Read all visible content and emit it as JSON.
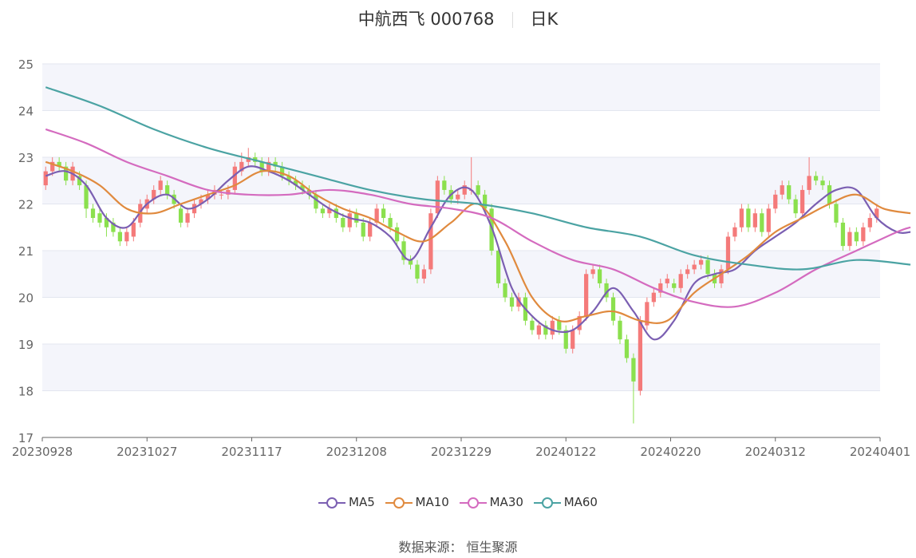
{
  "title": {
    "stock": "中航西飞 000768",
    "period": "日K"
  },
  "source": {
    "label": "数据来源：",
    "value": "恒生聚源"
  },
  "chart_data": {
    "type": "candlestick",
    "ylim": [
      17,
      25
    ],
    "yticks": [
      17,
      18,
      19,
      20,
      21,
      22,
      23,
      24,
      25
    ],
    "x_tick_labels": [
      "20230928",
      "20231027",
      "20231117",
      "20231208",
      "20231229",
      "20240122",
      "20240220",
      "20240312",
      "20240401"
    ],
    "grid": true,
    "legend_position": "bottom",
    "up_color": "#f47a7a",
    "down_color": "#8be04e",
    "candles": [
      [
        22.4,
        22.7,
        22.8,
        22.3
      ],
      [
        22.7,
        22.9,
        23.0,
        22.6
      ],
      [
        22.9,
        22.8,
        23.0,
        22.7
      ],
      [
        22.8,
        22.5,
        22.9,
        22.4
      ],
      [
        22.5,
        22.8,
        22.9,
        22.4
      ],
      [
        22.6,
        22.4,
        22.7,
        22.3
      ],
      [
        22.4,
        21.9,
        22.5,
        21.7
      ],
      [
        21.9,
        21.7,
        22.0,
        21.6
      ],
      [
        21.8,
        21.6,
        21.9,
        21.5
      ],
      [
        21.7,
        21.5,
        21.8,
        21.3
      ],
      [
        21.6,
        21.4,
        21.7,
        21.3
      ],
      [
        21.4,
        21.2,
        21.5,
        21.1
      ],
      [
        21.2,
        21.4,
        21.5,
        21.1
      ],
      [
        21.3,
        21.6,
        21.7,
        21.2
      ],
      [
        21.6,
        22.0,
        22.1,
        21.5
      ],
      [
        21.9,
        22.1,
        22.2,
        21.8
      ],
      [
        22.1,
        22.3,
        22.4,
        22.0
      ],
      [
        22.3,
        22.5,
        22.6,
        22.2
      ],
      [
        22.4,
        22.2,
        22.5,
        22.1
      ],
      [
        22.2,
        22.0,
        22.3,
        21.9
      ],
      [
        21.9,
        21.6,
        22.0,
        21.5
      ],
      [
        21.6,
        21.8,
        21.9,
        21.5
      ],
      [
        21.8,
        22.0,
        22.1,
        21.7
      ],
      [
        22.0,
        22.1,
        22.2,
        21.9
      ],
      [
        22.1,
        22.2,
        22.3,
        22.0
      ],
      [
        22.2,
        22.3,
        22.4,
        22.1
      ],
      [
        22.2,
        22.2,
        22.3,
        22.1
      ],
      [
        22.2,
        22.3,
        22.4,
        22.1
      ],
      [
        22.3,
        22.8,
        22.9,
        22.2
      ],
      [
        22.7,
        22.9,
        23.1,
        22.6
      ],
      [
        22.9,
        23.0,
        23.2,
        22.8
      ],
      [
        23.0,
        22.9,
        23.1,
        22.8
      ],
      [
        22.9,
        22.7,
        23.0,
        22.6
      ],
      [
        22.7,
        22.9,
        23.0,
        22.6
      ],
      [
        22.9,
        22.8,
        23.0,
        22.7
      ],
      [
        22.8,
        22.6,
        22.9,
        22.5
      ],
      [
        22.6,
        22.5,
        22.7,
        22.4
      ],
      [
        22.5,
        22.4,
        22.6,
        22.3
      ],
      [
        22.4,
        22.3,
        22.5,
        22.2
      ],
      [
        22.3,
        22.2,
        22.4,
        22.1
      ],
      [
        22.2,
        21.9,
        22.3,
        21.8
      ],
      [
        21.9,
        21.8,
        22.0,
        21.7
      ],
      [
        21.8,
        21.9,
        22.0,
        21.7
      ],
      [
        21.9,
        21.7,
        22.0,
        21.6
      ],
      [
        21.7,
        21.5,
        21.8,
        21.4
      ],
      [
        21.5,
        21.8,
        21.9,
        21.4
      ],
      [
        21.8,
        21.6,
        21.9,
        21.5
      ],
      [
        21.6,
        21.3,
        21.7,
        21.2
      ],
      [
        21.3,
        21.6,
        21.7,
        21.2
      ],
      [
        21.6,
        21.9,
        22.0,
        21.5
      ],
      [
        21.9,
        21.7,
        22.0,
        21.6
      ],
      [
        21.7,
        21.5,
        21.8,
        21.4
      ],
      [
        21.5,
        21.2,
        21.6,
        21.1
      ],
      [
        21.2,
        20.8,
        21.3,
        20.7
      ],
      [
        20.8,
        20.7,
        20.9,
        20.6
      ],
      [
        20.7,
        20.4,
        20.8,
        20.3
      ],
      [
        20.4,
        20.6,
        20.7,
        20.3
      ],
      [
        20.6,
        21.8,
        21.9,
        20.5
      ],
      [
        21.8,
        22.5,
        22.6,
        21.7
      ],
      [
        22.5,
        22.3,
        22.6,
        22.2
      ],
      [
        22.3,
        22.1,
        22.4,
        22.0
      ],
      [
        22.1,
        22.2,
        22.3,
        22.0
      ],
      [
        22.2,
        22.4,
        22.5,
        22.1
      ],
      [
        22.3,
        22.3,
        23.0,
        22.2
      ],
      [
        22.4,
        22.2,
        22.5,
        22.1
      ],
      [
        22.2,
        21.9,
        22.3,
        21.8
      ],
      [
        21.9,
        21.0,
        22.0,
        20.9
      ],
      [
        21.0,
        20.3,
        21.1,
        20.2
      ],
      [
        20.3,
        20.0,
        20.4,
        19.9
      ],
      [
        20.0,
        19.8,
        20.1,
        19.7
      ],
      [
        19.8,
        20.0,
        20.1,
        19.7
      ],
      [
        20.0,
        19.5,
        20.1,
        19.4
      ],
      [
        19.5,
        19.3,
        19.6,
        19.2
      ],
      [
        19.2,
        19.4,
        19.5,
        19.1
      ],
      [
        19.4,
        19.2,
        19.5,
        19.1
      ],
      [
        19.2,
        19.5,
        19.6,
        19.1
      ],
      [
        19.5,
        19.3,
        19.6,
        19.2
      ],
      [
        19.3,
        18.9,
        19.4,
        18.8
      ],
      [
        18.9,
        19.3,
        19.4,
        18.8
      ],
      [
        19.3,
        19.6,
        19.7,
        19.2
      ],
      [
        19.6,
        20.5,
        20.6,
        19.5
      ],
      [
        20.5,
        20.6,
        20.7,
        20.4
      ],
      [
        20.6,
        20.3,
        20.7,
        20.2
      ],
      [
        20.3,
        20.0,
        20.4,
        19.9
      ],
      [
        20.0,
        19.5,
        20.1,
        19.4
      ],
      [
        19.5,
        19.1,
        19.6,
        19.0
      ],
      [
        19.1,
        18.7,
        19.2,
        18.6
      ],
      [
        18.7,
        18.2,
        18.8,
        17.3
      ],
      [
        18.0,
        19.5,
        19.6,
        17.9
      ],
      [
        19.4,
        19.9,
        20.0,
        19.3
      ],
      [
        19.9,
        20.1,
        20.2,
        19.8
      ],
      [
        20.1,
        20.3,
        20.4,
        20.0
      ],
      [
        20.3,
        20.4,
        20.5,
        20.2
      ],
      [
        20.3,
        20.2,
        20.4,
        20.1
      ],
      [
        20.2,
        20.5,
        20.6,
        20.1
      ],
      [
        20.5,
        20.6,
        20.7,
        20.4
      ],
      [
        20.6,
        20.7,
        20.8,
        20.5
      ],
      [
        20.7,
        20.8,
        20.9,
        20.6
      ],
      [
        20.8,
        20.5,
        20.9,
        20.4
      ],
      [
        20.5,
        20.3,
        20.6,
        20.2
      ],
      [
        20.3,
        20.6,
        20.7,
        20.2
      ],
      [
        20.6,
        21.3,
        21.4,
        20.5
      ],
      [
        21.3,
        21.5,
        21.6,
        21.2
      ],
      [
        21.5,
        21.9,
        22.0,
        21.4
      ],
      [
        21.9,
        21.5,
        22.0,
        21.4
      ],
      [
        21.5,
        21.8,
        21.9,
        21.4
      ],
      [
        21.8,
        21.4,
        21.9,
        21.3
      ],
      [
        21.4,
        21.9,
        22.0,
        21.3
      ],
      [
        21.9,
        22.2,
        22.3,
        21.8
      ],
      [
        22.2,
        22.4,
        22.5,
        22.1
      ],
      [
        22.4,
        22.1,
        22.5,
        22.0
      ],
      [
        22.1,
        21.8,
        22.2,
        21.7
      ],
      [
        21.8,
        22.3,
        22.4,
        21.7
      ],
      [
        22.3,
        22.6,
        23.0,
        22.2
      ],
      [
        22.6,
        22.5,
        22.7,
        22.4
      ],
      [
        22.5,
        22.4,
        22.6,
        22.3
      ],
      [
        22.4,
        22.0,
        22.5,
        21.9
      ],
      [
        22.0,
        21.6,
        22.1,
        21.5
      ],
      [
        21.6,
        21.1,
        21.7,
        21.0
      ],
      [
        21.1,
        21.4,
        21.5,
        21.0
      ],
      [
        21.4,
        21.2,
        21.5,
        21.1
      ],
      [
        21.2,
        21.5,
        21.6,
        21.1
      ],
      [
        21.5,
        21.7,
        21.8,
        21.4
      ],
      [
        21.7,
        21.9,
        22.0,
        21.6
      ]
    ],
    "series": [
      {
        "name": "MA5",
        "color": "#7b5fb2",
        "points": [
          [
            0,
            22.6
          ],
          [
            3,
            22.7
          ],
          [
            6,
            22.4
          ],
          [
            9,
            21.7
          ],
          [
            12,
            21.5
          ],
          [
            15,
            22.0
          ],
          [
            18,
            22.2
          ],
          [
            21,
            21.9
          ],
          [
            24,
            22.1
          ],
          [
            27,
            22.5
          ],
          [
            30,
            22.8
          ],
          [
            33,
            22.7
          ],
          [
            36,
            22.5
          ],
          [
            39,
            22.2
          ],
          [
            42,
            21.9
          ],
          [
            45,
            21.7
          ],
          [
            48,
            21.6
          ],
          [
            51,
            21.3
          ],
          [
            54,
            20.8
          ],
          [
            57,
            21.5
          ],
          [
            60,
            22.2
          ],
          [
            63,
            22.3
          ],
          [
            66,
            21.5
          ],
          [
            69,
            20.2
          ],
          [
            72,
            19.6
          ],
          [
            75,
            19.3
          ],
          [
            78,
            19.3
          ],
          [
            81,
            19.7
          ],
          [
            84,
            20.2
          ],
          [
            87,
            19.7
          ],
          [
            90,
            19.1
          ],
          [
            93,
            19.5
          ],
          [
            96,
            20.3
          ],
          [
            99,
            20.5
          ],
          [
            102,
            20.6
          ],
          [
            105,
            21.0
          ],
          [
            108,
            21.3
          ],
          [
            111,
            21.6
          ],
          [
            114,
            22.0
          ],
          [
            117,
            22.3
          ],
          [
            120,
            22.3
          ],
          [
            123,
            21.7
          ],
          [
            126,
            21.4
          ],
          [
            128,
            21.4
          ]
        ]
      },
      {
        "name": "MA10",
        "color": "#e08a3e",
        "points": [
          [
            0,
            22.9
          ],
          [
            4,
            22.7
          ],
          [
            8,
            22.4
          ],
          [
            12,
            21.9
          ],
          [
            16,
            21.8
          ],
          [
            20,
            22.0
          ],
          [
            24,
            22.2
          ],
          [
            28,
            22.4
          ],
          [
            32,
            22.7
          ],
          [
            36,
            22.6
          ],
          [
            40,
            22.2
          ],
          [
            44,
            21.9
          ],
          [
            48,
            21.7
          ],
          [
            52,
            21.4
          ],
          [
            56,
            21.2
          ],
          [
            60,
            21.6
          ],
          [
            64,
            22.0
          ],
          [
            68,
            21.2
          ],
          [
            72,
            20.0
          ],
          [
            76,
            19.5
          ],
          [
            80,
            19.6
          ],
          [
            84,
            19.7
          ],
          [
            88,
            19.5
          ],
          [
            92,
            19.5
          ],
          [
            96,
            20.1
          ],
          [
            100,
            20.5
          ],
          [
            104,
            20.9
          ],
          [
            108,
            21.4
          ],
          [
            112,
            21.7
          ],
          [
            116,
            22.0
          ],
          [
            120,
            22.2
          ],
          [
            124,
            21.9
          ],
          [
            128,
            21.8
          ]
        ]
      },
      {
        "name": "MA30",
        "color": "#d46bbf",
        "points": [
          [
            0,
            23.6
          ],
          [
            6,
            23.3
          ],
          [
            12,
            22.9
          ],
          [
            18,
            22.6
          ],
          [
            24,
            22.3
          ],
          [
            30,
            22.2
          ],
          [
            36,
            22.2
          ],
          [
            42,
            22.3
          ],
          [
            48,
            22.2
          ],
          [
            54,
            22.0
          ],
          [
            60,
            21.9
          ],
          [
            66,
            21.7
          ],
          [
            72,
            21.2
          ],
          [
            78,
            20.8
          ],
          [
            84,
            20.6
          ],
          [
            90,
            20.2
          ],
          [
            96,
            19.9
          ],
          [
            102,
            19.8
          ],
          [
            108,
            20.1
          ],
          [
            114,
            20.6
          ],
          [
            120,
            21.0
          ],
          [
            126,
            21.4
          ],
          [
            128,
            21.5
          ]
        ]
      },
      {
        "name": "MA60",
        "color": "#4ba3a3",
        "points": [
          [
            0,
            24.5
          ],
          [
            8,
            24.1
          ],
          [
            16,
            23.6
          ],
          [
            24,
            23.2
          ],
          [
            32,
            22.9
          ],
          [
            40,
            22.6
          ],
          [
            48,
            22.3
          ],
          [
            56,
            22.1
          ],
          [
            64,
            22.0
          ],
          [
            72,
            21.8
          ],
          [
            80,
            21.5
          ],
          [
            88,
            21.3
          ],
          [
            96,
            20.9
          ],
          [
            104,
            20.7
          ],
          [
            112,
            20.6
          ],
          [
            120,
            20.8
          ],
          [
            128,
            20.7
          ]
        ]
      }
    ]
  }
}
